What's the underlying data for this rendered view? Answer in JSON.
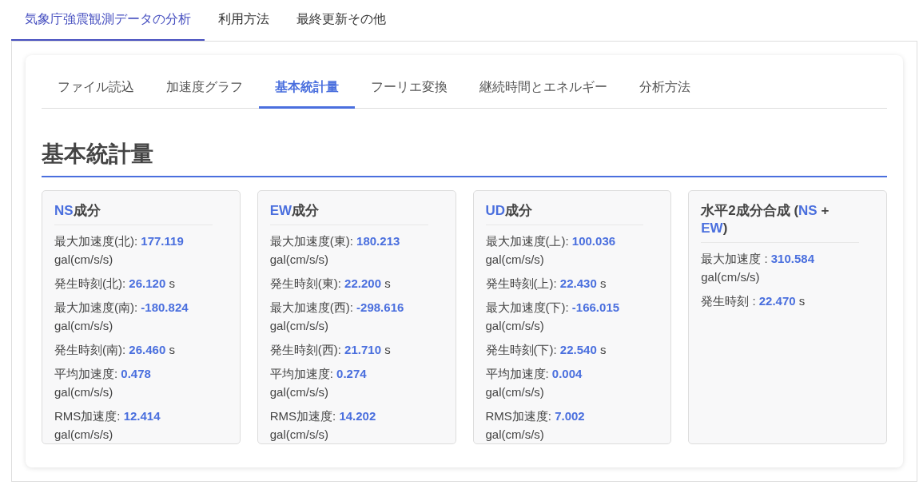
{
  "main_tabs": [
    {
      "label": "気象庁強震観測データの分析",
      "selected": true
    },
    {
      "label": "利用方法",
      "selected": false
    },
    {
      "label": "最終更新その他",
      "selected": false
    }
  ],
  "sub_tabs": [
    {
      "label": "ファイル読込",
      "selected": false
    },
    {
      "label": "加速度グラフ",
      "selected": false
    },
    {
      "label": "基本統計量",
      "selected": true
    },
    {
      "label": "フーリエ変換",
      "selected": false
    },
    {
      "label": "継続時間とエネルギー",
      "selected": false
    },
    {
      "label": "分析方法",
      "selected": false
    }
  ],
  "heading": "基本統計量",
  "cards": [
    {
      "title": [
        {
          "text": "NS",
          "highlight": true
        },
        {
          "text": "成分",
          "highlight": false
        }
      ],
      "stats": [
        {
          "label": "最大加速度(北):",
          "value": "177.119",
          "unit": "gal(cm/s/s)"
        },
        {
          "label": "発生時刻(北):",
          "value": "26.120",
          "unit": "s"
        },
        {
          "label": "最大加速度(南):",
          "value": "-180.824",
          "unit": "gal(cm/s/s)"
        },
        {
          "label": "発生時刻(南):",
          "value": "26.460",
          "unit": "s"
        },
        {
          "label": "平均加速度:",
          "value": "0.478",
          "unit": "gal(cm/s/s)"
        },
        {
          "label": "RMS加速度:",
          "value": "12.414",
          "unit": "gal(cm/s/s)"
        }
      ]
    },
    {
      "title": [
        {
          "text": "EW",
          "highlight": true
        },
        {
          "text": "成分",
          "highlight": false
        }
      ],
      "stats": [
        {
          "label": "最大加速度(東):",
          "value": "180.213",
          "unit": "gal(cm/s/s)"
        },
        {
          "label": "発生時刻(東):",
          "value": "22.200",
          "unit": "s"
        },
        {
          "label": "最大加速度(西):",
          "value": "-298.616",
          "unit": "gal(cm/s/s)"
        },
        {
          "label": "発生時刻(西):",
          "value": "21.710",
          "unit": "s"
        },
        {
          "label": "平均加速度:",
          "value": "0.274",
          "unit": "gal(cm/s/s)"
        },
        {
          "label": "RMS加速度:",
          "value": "14.202",
          "unit": "gal(cm/s/s)"
        }
      ]
    },
    {
      "title": [
        {
          "text": "UD",
          "highlight": true
        },
        {
          "text": "成分",
          "highlight": false
        }
      ],
      "stats": [
        {
          "label": "最大加速度(上):",
          "value": "100.036",
          "unit": "gal(cm/s/s)"
        },
        {
          "label": "発生時刻(上):",
          "value": "22.430",
          "unit": "s"
        },
        {
          "label": "最大加速度(下):",
          "value": "-166.015",
          "unit": "gal(cm/s/s)"
        },
        {
          "label": "発生時刻(下):",
          "value": "22.540",
          "unit": "s"
        },
        {
          "label": "平均加速度:",
          "value": "0.004",
          "unit": "gal(cm/s/s)"
        },
        {
          "label": "RMS加速度:",
          "value": "7.002",
          "unit": "gal(cm/s/s)"
        }
      ]
    },
    {
      "title": [
        {
          "text": "水平2成分合成 (",
          "highlight": false
        },
        {
          "text": "NS",
          "highlight": true
        },
        {
          "text": " + ",
          "highlight": false
        },
        {
          "text": "EW",
          "highlight": true
        },
        {
          "text": ")",
          "highlight": false
        }
      ],
      "stats": [
        {
          "label": "最大加速度 :",
          "value": "310.584",
          "unit": "gal(cm/s/s)"
        },
        {
          "label": "発生時刻 :",
          "value": "22.470",
          "unit": "s"
        }
      ]
    }
  ]
}
